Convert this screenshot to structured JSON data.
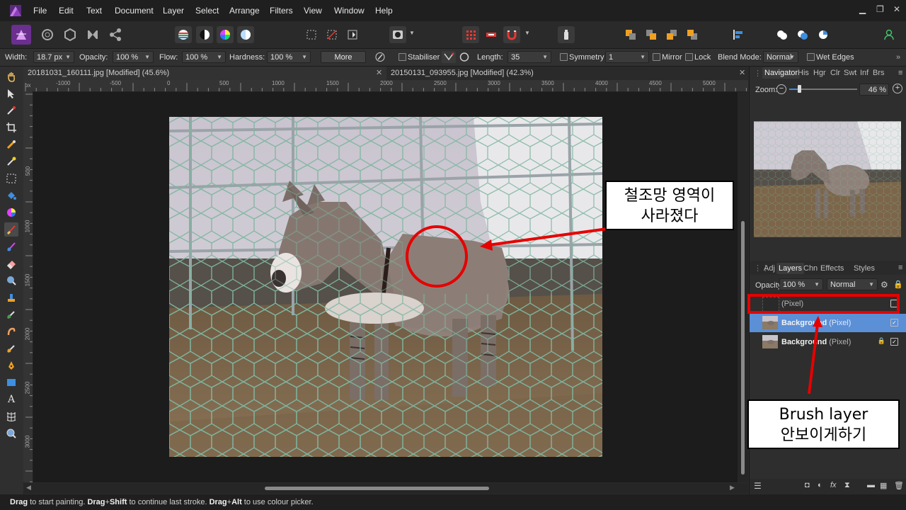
{
  "menu": [
    "File",
    "Edit",
    "Text",
    "Document",
    "Layer",
    "Select",
    "Arrange",
    "Filters",
    "View",
    "Window",
    "Help"
  ],
  "context": {
    "width_label": "Width:",
    "width_value": "18.7 px",
    "opacity_label": "Opacity:",
    "opacity_value": "100 %",
    "flow_label": "Flow:",
    "flow_value": "100 %",
    "hardness_label": "Hardness:",
    "hardness_value": "100 %",
    "more_label": "More",
    "stabiliser_label": "Stabiliser",
    "length_label": "Length:",
    "length_value": "35",
    "symmetry_label": "Symmetry",
    "symmetry_value": "1",
    "mirror_label": "Mirror",
    "lock_label": "Lock",
    "blend_label": "Blend Mode:",
    "blend_value": "Normal",
    "wetedges_label": "Wet Edges"
  },
  "tabs": [
    {
      "label": "20181031_160111.jpg [Modified] (45.6%)",
      "close": "✕"
    },
    {
      "label": "20150131_093955.jpg [Modified] (42.3%)",
      "close": "✕"
    }
  ],
  "ruler": {
    "unit": "px",
    "top": [
      "-1000",
      "-500",
      "0",
      "500",
      "1000",
      "1500",
      "2000",
      "2500",
      "3000",
      "3500",
      "4000",
      "4500",
      "5000"
    ],
    "left": [
      "500",
      "1000",
      "1500",
      "2000",
      "2500",
      "3000"
    ]
  },
  "navigator": {
    "tabs": [
      "Navigator",
      "His",
      "Hgr",
      "Clr",
      "Swt",
      "Inf",
      "Brs"
    ],
    "zoom_label": "Zoom:",
    "zoom_value": "46 %"
  },
  "layers_panel": {
    "tabs": [
      "Adj",
      "Layers",
      "Chn",
      "Effects",
      "Styles"
    ],
    "opacity_label": "Opacity:",
    "opacity_value": "100 %",
    "blend_value": "Normal",
    "layers": [
      {
        "name": "",
        "type": "(Pixel)",
        "visible": false
      },
      {
        "name": "Background",
        "type": "(Pixel)",
        "visible": true,
        "selected": true
      },
      {
        "name": "Background",
        "type": "(Pixel)",
        "visible": true,
        "locked": true
      }
    ]
  },
  "annotations": {
    "callout1_line1": "철조망 영역이",
    "callout1_line2": "사라졌다",
    "callout2_line1": "Brush layer",
    "callout2_line2": "안보이게하기"
  },
  "status": {
    "p1_bold": "Drag",
    "p1": " to start painting. ",
    "p2_bold": "Drag",
    "p2_plus": "+",
    "p2_bold2": "Shift",
    "p2": " to continue last stroke. ",
    "p3_bold": "Drag",
    "p3_plus": "+",
    "p3_bold2": "Alt",
    "p3": " to use colour picker."
  },
  "colors": {
    "accent": "#5b8fd6",
    "annotation_red": "#e60000",
    "persona_active": "#7a3c9c"
  }
}
